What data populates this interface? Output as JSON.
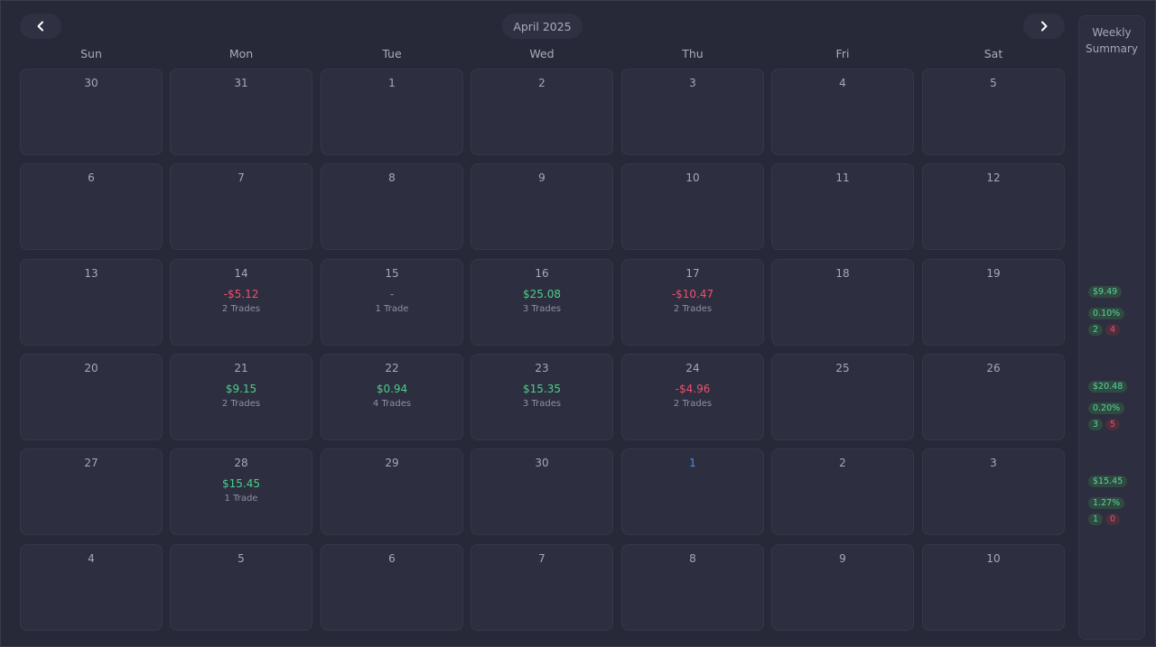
{
  "header": {
    "month_title": "April 2025",
    "prev_icon": "chevron-left-icon",
    "next_icon": "chevron-right-icon"
  },
  "weekdays": [
    "Sun",
    "Mon",
    "Tue",
    "Wed",
    "Thu",
    "Fri",
    "Sat"
  ],
  "weeks": [
    [
      {
        "day": "30"
      },
      {
        "day": "31"
      },
      {
        "day": "1"
      },
      {
        "day": "2"
      },
      {
        "day": "3"
      },
      {
        "day": "4"
      },
      {
        "day": "5"
      }
    ],
    [
      {
        "day": "6"
      },
      {
        "day": "7"
      },
      {
        "day": "8"
      },
      {
        "day": "9"
      },
      {
        "day": "10"
      },
      {
        "day": "11"
      },
      {
        "day": "12"
      }
    ],
    [
      {
        "day": "13"
      },
      {
        "day": "14",
        "pnl": "-$5.12",
        "trades": "2 Trades",
        "tone": "neg"
      },
      {
        "day": "15",
        "pnl": "-",
        "trades": "1 Trade",
        "tone": "neu"
      },
      {
        "day": "16",
        "pnl": "$25.08",
        "trades": "3 Trades",
        "tone": "pos"
      },
      {
        "day": "17",
        "pnl": "-$10.47",
        "trades": "2 Trades",
        "tone": "neg"
      },
      {
        "day": "18"
      },
      {
        "day": "19"
      }
    ],
    [
      {
        "day": "20"
      },
      {
        "day": "21",
        "pnl": "$9.15",
        "trades": "2 Trades",
        "tone": "pos"
      },
      {
        "day": "22",
        "pnl": "$0.94",
        "trades": "4 Trades",
        "tone": "pos"
      },
      {
        "day": "23",
        "pnl": "$15.35",
        "trades": "3 Trades",
        "tone": "pos"
      },
      {
        "day": "24",
        "pnl": "-$4.96",
        "trades": "2 Trades",
        "tone": "neg"
      },
      {
        "day": "25"
      },
      {
        "day": "26"
      }
    ],
    [
      {
        "day": "27"
      },
      {
        "day": "28",
        "pnl": "$15.45",
        "trades": "1 Trade",
        "tone": "pos"
      },
      {
        "day": "29"
      },
      {
        "day": "30"
      },
      {
        "day": "1",
        "today": true
      },
      {
        "day": "2"
      },
      {
        "day": "3"
      }
    ],
    [
      {
        "day": "4"
      },
      {
        "day": "5"
      },
      {
        "day": "6"
      },
      {
        "day": "7"
      },
      {
        "day": "8"
      },
      {
        "day": "9"
      },
      {
        "day": "10"
      }
    ]
  ],
  "weekly_summary": {
    "title": "Weekly Summary",
    "weeks": [
      {
        "week_index": 2,
        "pnl": "$9.49",
        "percent": "0.10%",
        "wins": "2",
        "losses": "4"
      },
      {
        "week_index": 3,
        "pnl": "$20.48",
        "percent": "0.20%",
        "wins": "3",
        "losses": "5"
      },
      {
        "week_index": 4,
        "pnl": "$15.45",
        "percent": "1.27%",
        "wins": "1",
        "losses": "0"
      }
    ]
  },
  "colors": {
    "background": "#272838",
    "cell": "#2d2e3f",
    "positive": "#4ccf8a",
    "negative": "#f0506e",
    "today": "#4a90e2"
  }
}
